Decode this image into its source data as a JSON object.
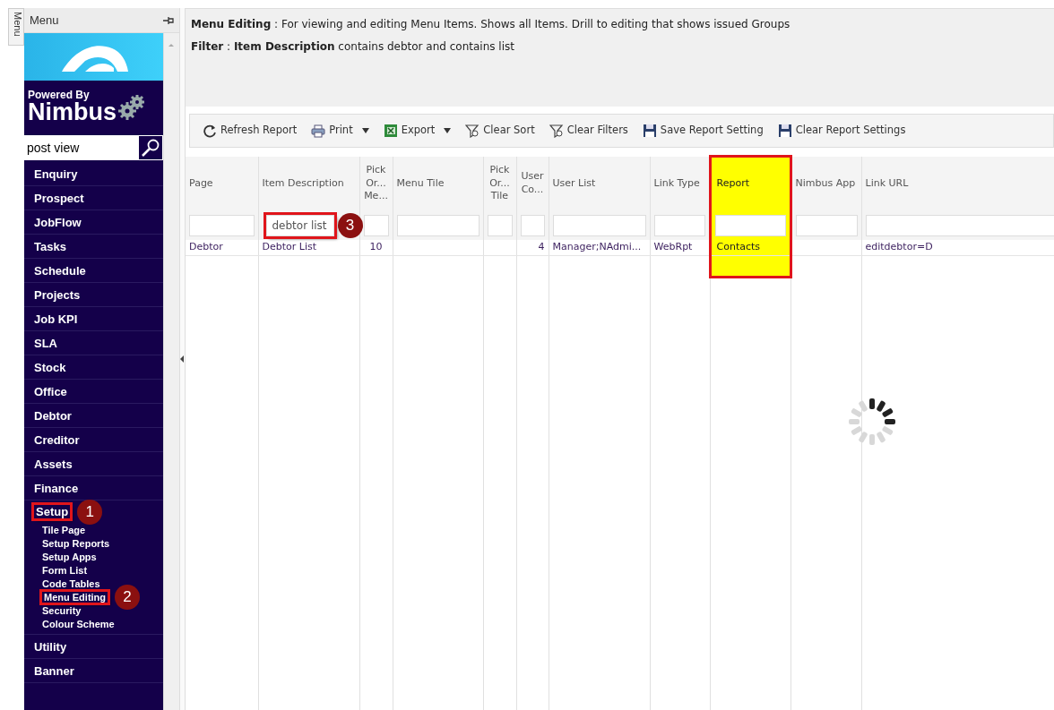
{
  "side_tab": {
    "label": "Menu"
  },
  "sidebar": {
    "title": "Menu",
    "search": {
      "value": "post view"
    },
    "logo": {
      "tagline": "Powered By",
      "brand": "Nimbus"
    },
    "items": [
      {
        "label": "Enquiry",
        "highlighted": false
      },
      {
        "label": "Prospect",
        "highlighted": false
      },
      {
        "label": "JobFlow",
        "highlighted": false
      },
      {
        "label": "Tasks",
        "highlighted": false
      },
      {
        "label": "Schedule",
        "highlighted": false
      },
      {
        "label": "Projects",
        "highlighted": false
      },
      {
        "label": "Job KPI",
        "highlighted": false
      },
      {
        "label": "SLA",
        "highlighted": false
      },
      {
        "label": "Stock",
        "highlighted": false
      },
      {
        "label": "Office",
        "highlighted": false
      },
      {
        "label": "Debtor",
        "highlighted": false
      },
      {
        "label": "Creditor",
        "highlighted": false
      },
      {
        "label": "Assets",
        "highlighted": false
      },
      {
        "label": "Finance",
        "highlighted": false
      },
      {
        "label": "Setup",
        "highlighted": true,
        "callout": "1",
        "children": [
          {
            "label": "Tile Page",
            "highlighted": false
          },
          {
            "label": "Setup Reports",
            "highlighted": false
          },
          {
            "label": "Setup Apps",
            "highlighted": false
          },
          {
            "label": "Form List",
            "highlighted": false
          },
          {
            "label": "Code Tables",
            "highlighted": false
          },
          {
            "label": "Menu Editing",
            "highlighted": true,
            "callout": "2"
          },
          {
            "label": "Security",
            "highlighted": false
          },
          {
            "label": "Colour Scheme",
            "highlighted": false
          }
        ]
      },
      {
        "label": "Utility",
        "highlighted": false
      },
      {
        "label": "Banner",
        "highlighted": false
      }
    ]
  },
  "report": {
    "description": "**Menu Editing** : For viewing and editing Menu Items. Shows all Items. Drill to editing that shows issued Groups",
    "filter_text": "**Filter** : **Item Description** contains debtor and contains list",
    "toolbar": [
      {
        "label": "Refresh Report",
        "kind": "refresh",
        "dropdown": false
      },
      {
        "label": "Print",
        "kind": "print",
        "dropdown": true
      },
      {
        "label": "Export",
        "kind": "excel",
        "dropdown": true
      },
      {
        "label": "Clear Sort",
        "kind": "funnel",
        "dropdown": false
      },
      {
        "label": "Clear Filters",
        "kind": "funnel",
        "dropdown": false
      },
      {
        "label": "Save Report Setting",
        "kind": "save",
        "dropdown": false
      },
      {
        "label": "Clear Report Settings",
        "kind": "save",
        "dropdown": false
      }
    ],
    "table": {
      "columns": [
        {
          "label": "Page",
          "highlighted": false
        },
        {
          "label": "Item Description",
          "highlighted": false,
          "filter": {
            "value": "debtor list",
            "highlighted": true,
            "callout": "3"
          }
        },
        {
          "label": "Pick Or... Me...",
          "highlighted": false
        },
        {
          "label": "Menu Tile",
          "highlighted": false
        },
        {
          "label": "Pick Or... Tile",
          "highlighted": false
        },
        {
          "label": "User Co...",
          "highlighted": false
        },
        {
          "label": "User List",
          "highlighted": false
        },
        {
          "label": "Link Type",
          "highlighted": false
        },
        {
          "label": "Report",
          "highlighted": true
        },
        {
          "label": "Nimbus App",
          "highlighted": false
        },
        {
          "label": "Link URL",
          "highlighted": false
        }
      ],
      "rows": [
        {
          "cells": [
            "Debtor",
            "Debtor List",
            "10",
            null,
            null,
            "4",
            "Manager;NAdmi...",
            "WebRpt",
            "Contacts",
            null,
            "editdebtor=D"
          ]
        }
      ]
    }
  }
}
